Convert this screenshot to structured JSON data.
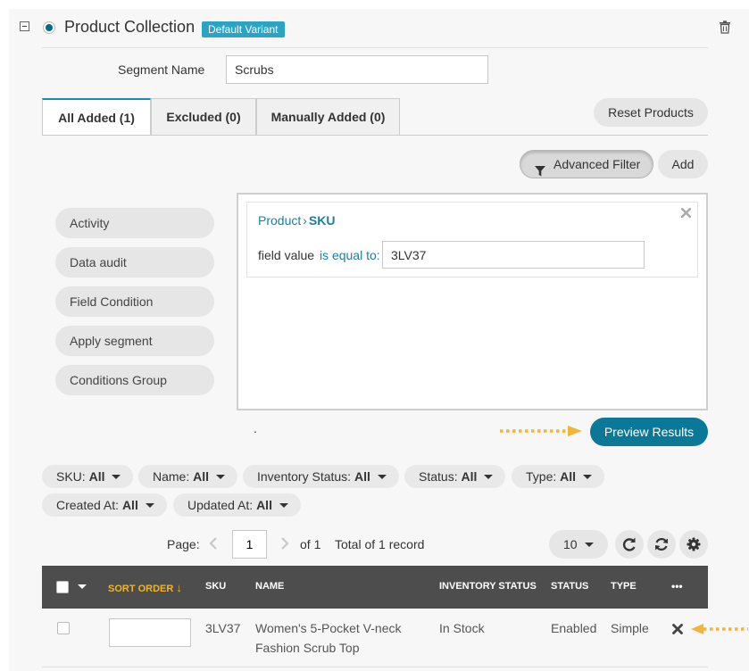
{
  "header": {
    "title": "Product Collection",
    "badge": "Default Variant"
  },
  "segment": {
    "label": "Segment Name",
    "value": "Scrubs"
  },
  "tabs": [
    {
      "label": "All Added (1)",
      "active": true
    },
    {
      "label": "Excluded (0)",
      "active": false
    },
    {
      "label": "Manually Added (0)",
      "active": false
    }
  ],
  "toolbar": {
    "reset_label": "Reset Products",
    "advanced_filter_label": "Advanced Filter",
    "add_label": "Add"
  },
  "sidebar": {
    "items": [
      {
        "label": "Activity"
      },
      {
        "label": "Data audit"
      },
      {
        "label": "Field Condition"
      },
      {
        "label": "Apply segment"
      },
      {
        "label": "Conditions Group"
      }
    ]
  },
  "condition": {
    "entity": "Product",
    "separator": "›",
    "field": "SKU",
    "field_value_label": "field value",
    "operator": "is equal to:",
    "value": "3LV37",
    "dot": "."
  },
  "preview_label": "Preview Results",
  "filters": [
    {
      "label": "SKU:",
      "value": "All"
    },
    {
      "label": "Name:",
      "value": "All"
    },
    {
      "label": "Inventory Status:",
      "value": "All"
    },
    {
      "label": "Status:",
      "value": "All"
    },
    {
      "label": "Type:",
      "value": "All"
    },
    {
      "label": "Created At:",
      "value": "All"
    },
    {
      "label": "Updated At:",
      "value": "All"
    }
  ],
  "pagination": {
    "page_label": "Page:",
    "page": "1",
    "of_label": "of 1",
    "total_label": "Total of 1 record",
    "page_size": "10"
  },
  "table": {
    "columns": [
      "SORT ORDER",
      "SKU",
      "NAME",
      "INVENTORY STATUS",
      "STATUS",
      "TYPE",
      "•••"
    ],
    "rows": [
      {
        "sort_order": "",
        "sku": "3LV37",
        "name_line1": "Women's 5-Pocket V-neck",
        "name_line2": "Fashion Scrub Top",
        "inventory_status": "In Stock",
        "status": "Enabled",
        "type": "Simple"
      }
    ]
  },
  "colors": {
    "accent": "#0a7896",
    "badge": "#2ba3c4",
    "link": "#1a7fa0",
    "table_header": "#4d4d4d",
    "sort_column": "#f0b429",
    "arrow": "#f3b43a"
  }
}
